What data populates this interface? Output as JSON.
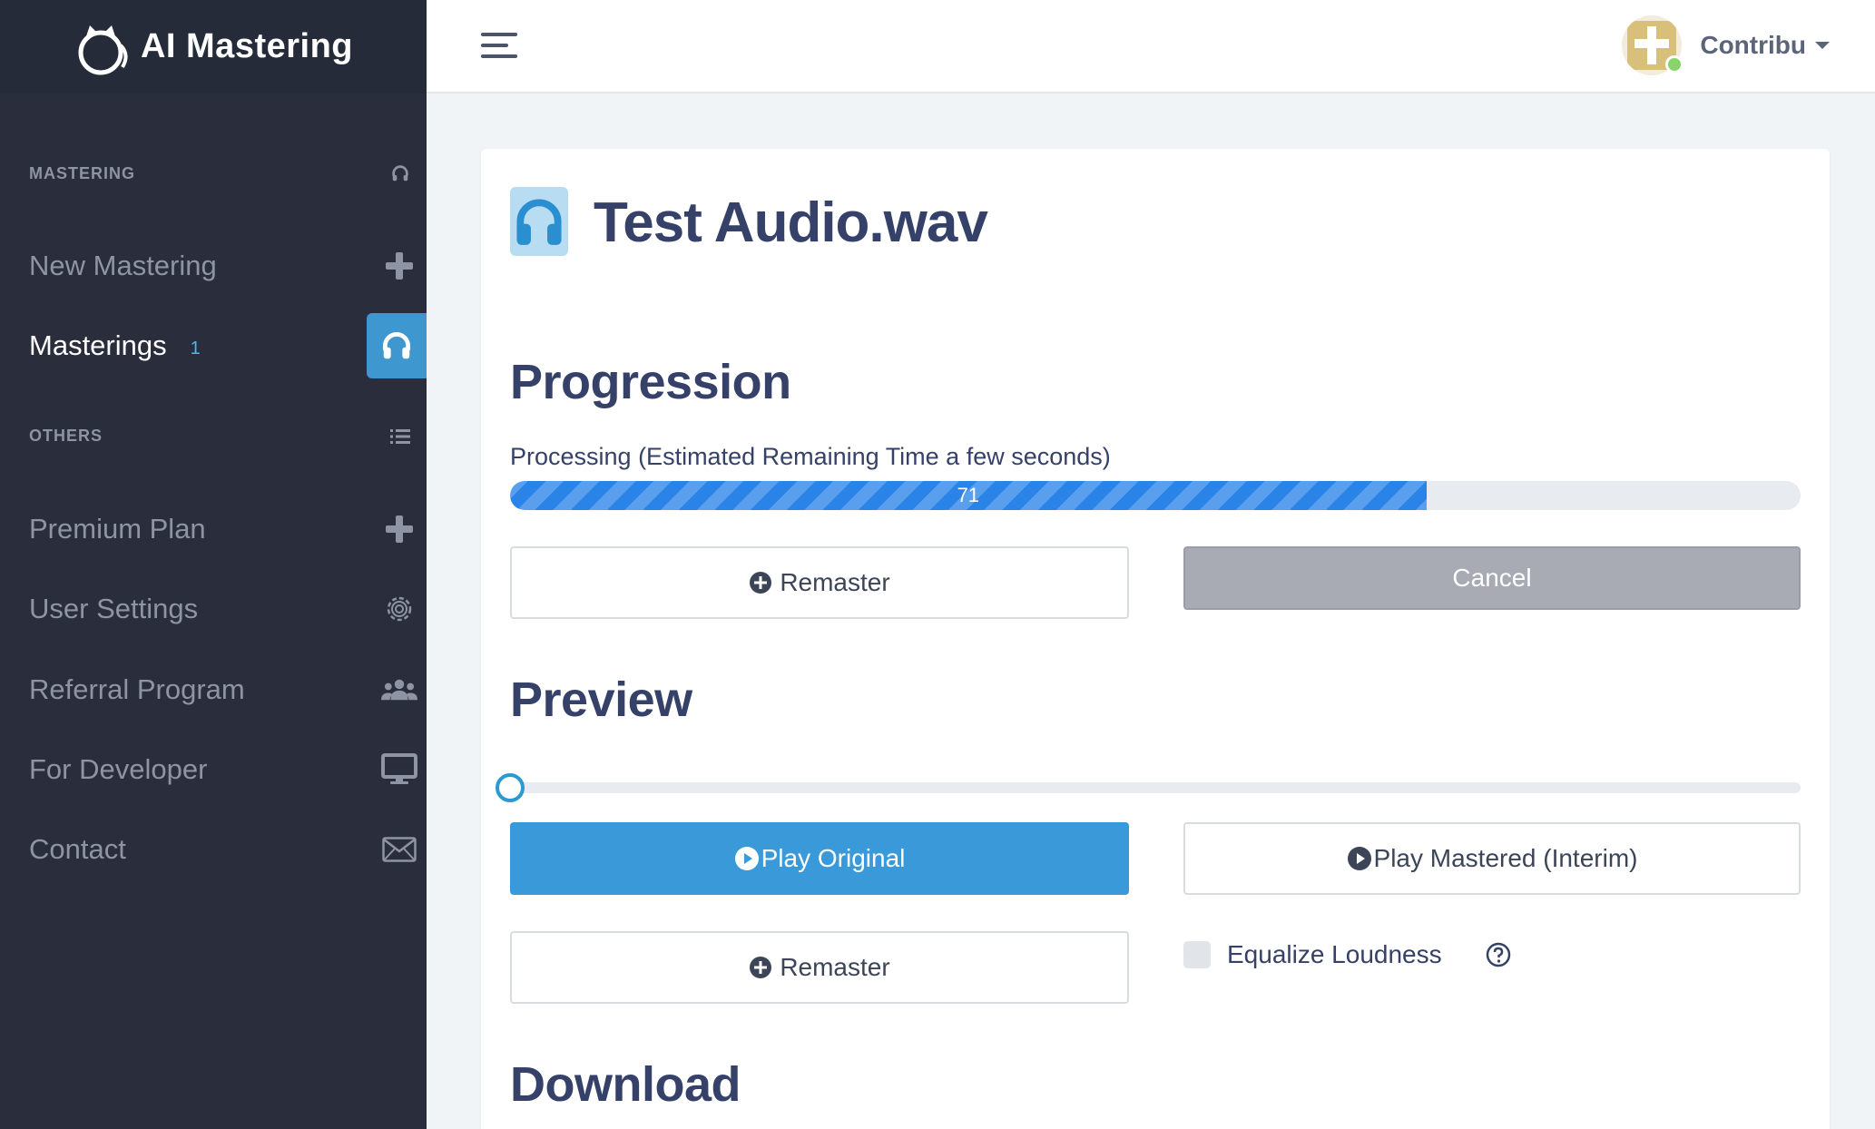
{
  "brand": {
    "name": "AI Mastering"
  },
  "sidebar": {
    "section_mastering": "MASTERING",
    "section_others": "OTHERS",
    "items": [
      {
        "label": "New Mastering",
        "icon": "plus-icon"
      },
      {
        "label": "Masterings",
        "badge": "1",
        "icon": "headphones-icon",
        "active": true
      },
      {
        "label": "Premium Plan",
        "icon": "plus-icon"
      },
      {
        "label": "User Settings",
        "icon": "gear-icon"
      },
      {
        "label": "Referral Program",
        "icon": "users-icon"
      },
      {
        "label": "For Developer",
        "icon": "monitor-icon"
      },
      {
        "label": "Contact",
        "icon": "envelope-icon"
      }
    ]
  },
  "topbar": {
    "user_name": "Contribu"
  },
  "main": {
    "file_title": "Test Audio.wav",
    "progression_heading": "Progression",
    "status_text": "Processing (Estimated Remaining Time a few seconds)",
    "progress_value": "71",
    "progress_percent": 71,
    "remaster_label": "Remaster",
    "cancel_label": "Cancel",
    "preview_heading": "Preview",
    "play_original_label": "Play Original",
    "play_mastered_label": "Play Mastered (Interim)",
    "remaster_label_2": "Remaster",
    "equalize_label": "Equalize Loudness",
    "download_heading": "Download"
  },
  "colors": {
    "sidebar_bg": "#2a2d3b",
    "accent": "#3a9ad9",
    "progress": "#2a84e8",
    "heading": "#354168"
  }
}
